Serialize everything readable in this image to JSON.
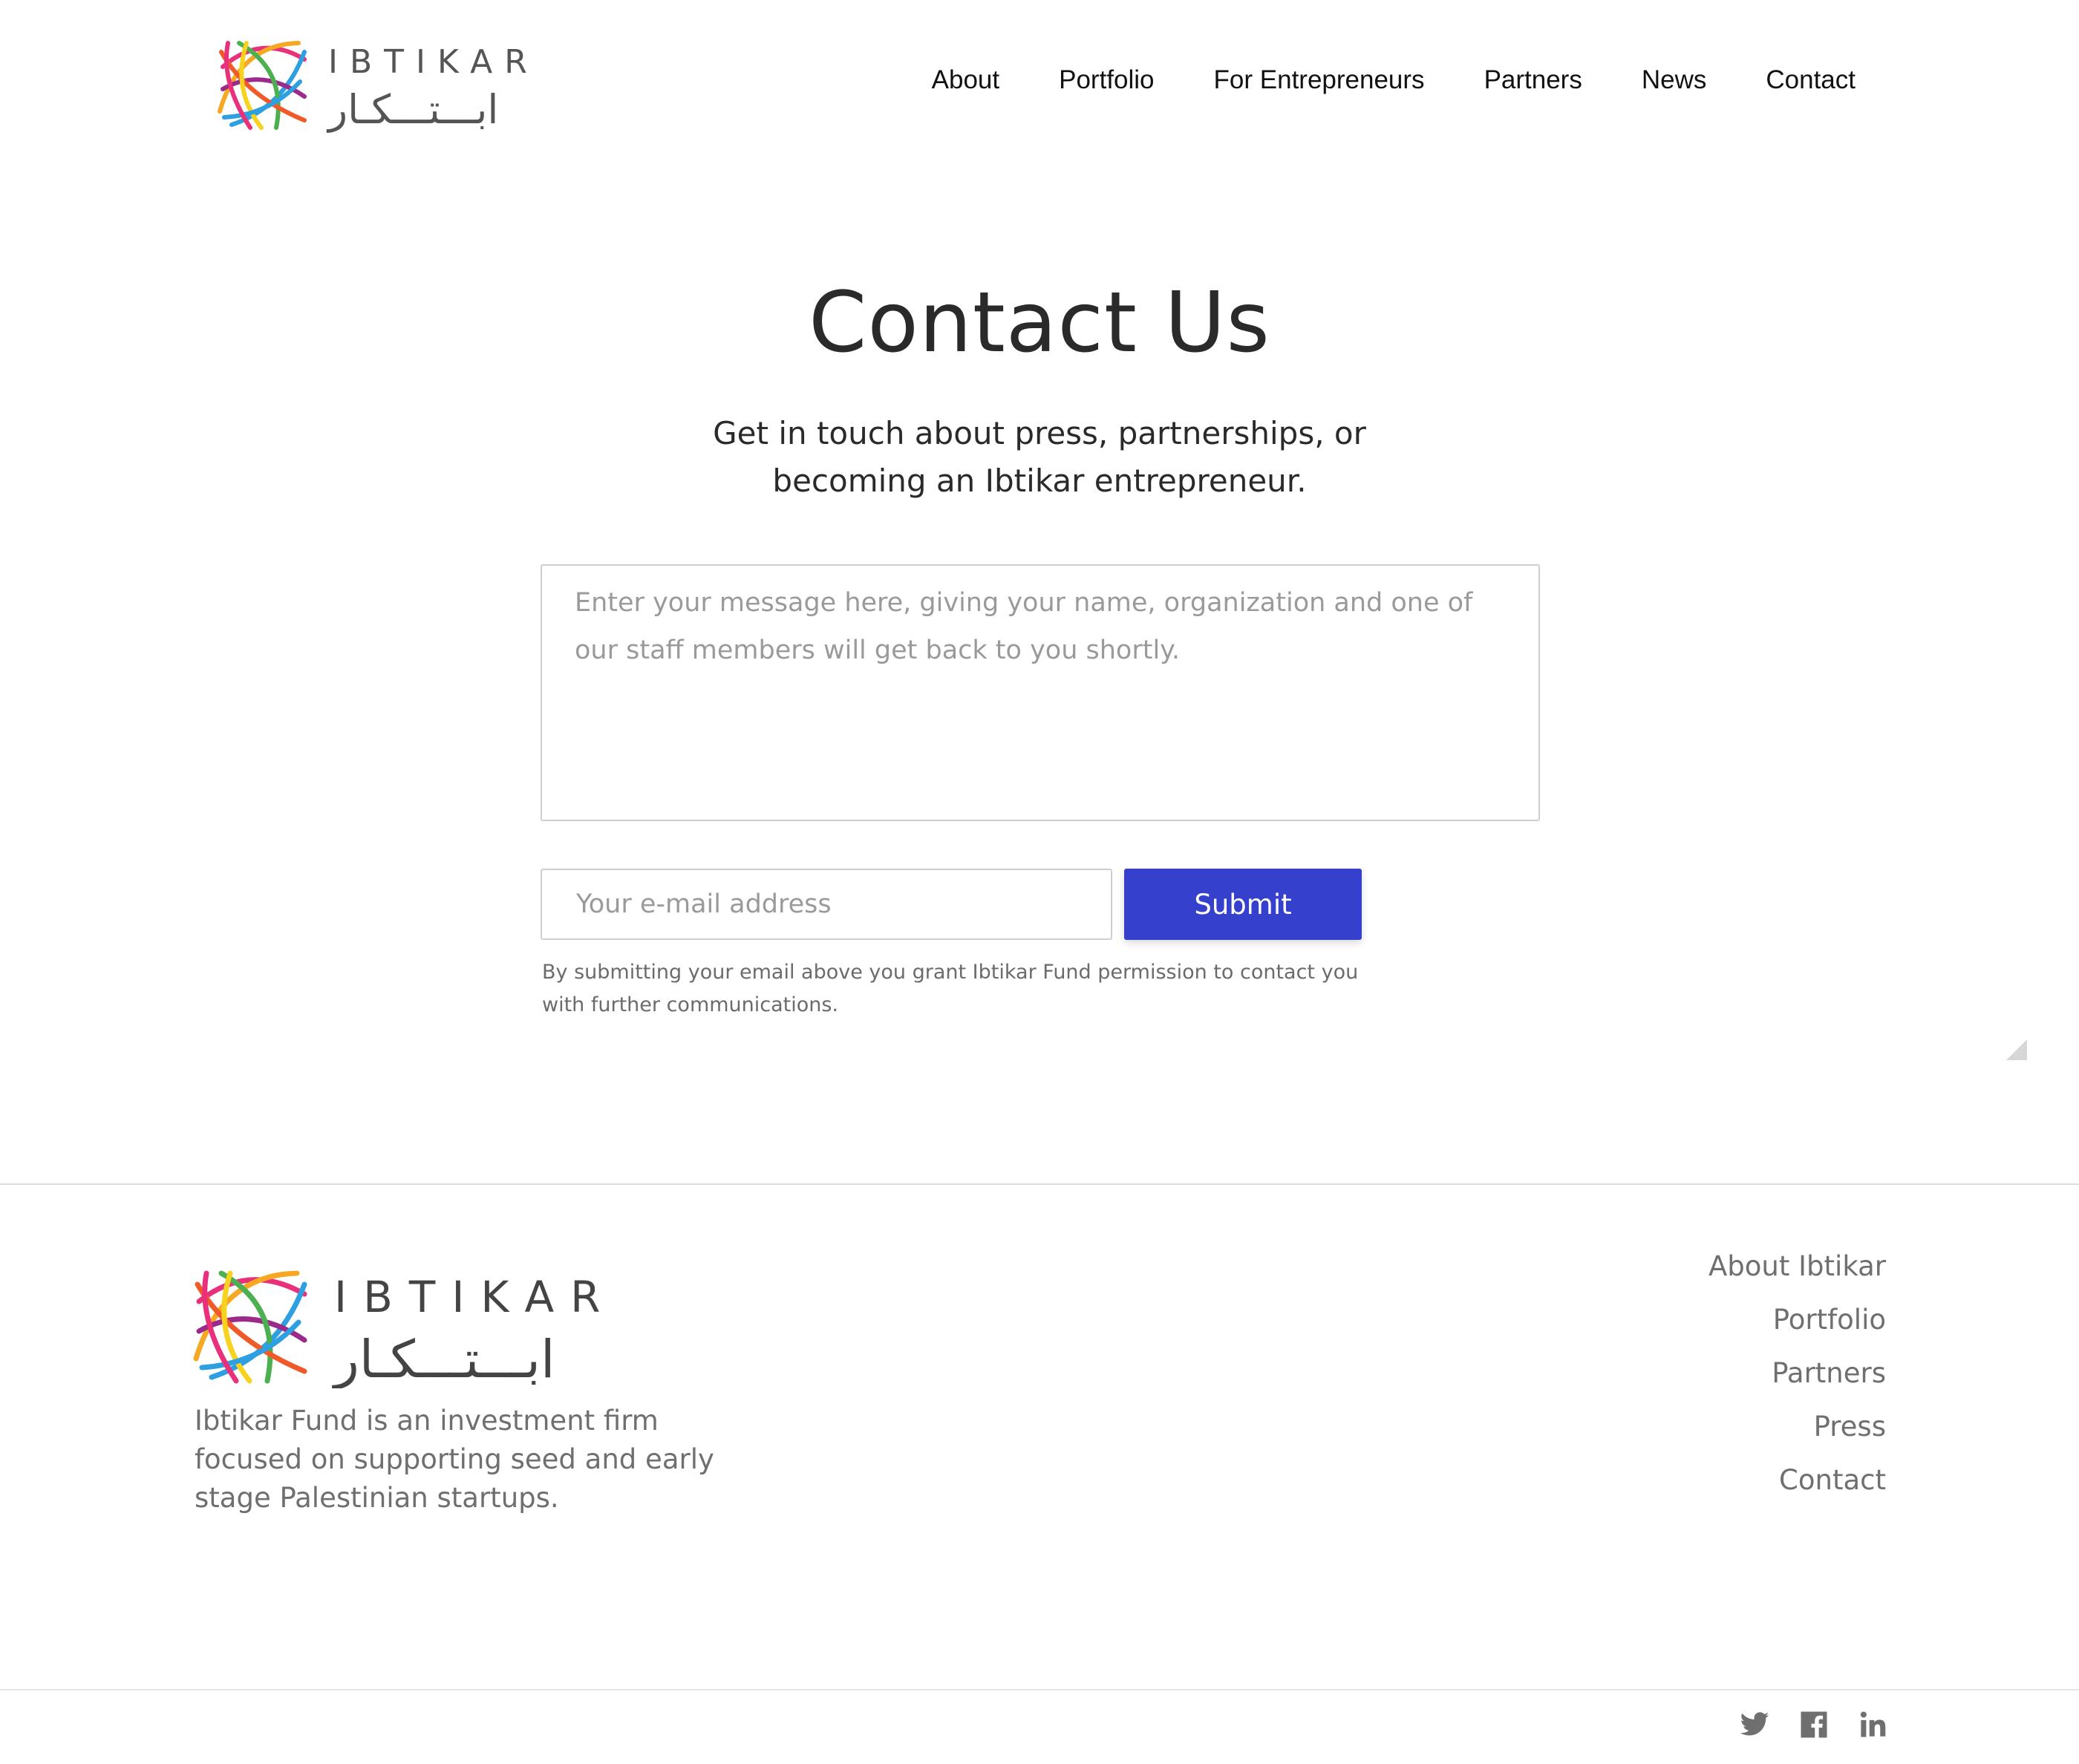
{
  "header": {
    "logo": {
      "latin": "IBTIKAR",
      "arabic": "ابـــتـــكـار"
    },
    "nav": [
      {
        "label": "About"
      },
      {
        "label": "Portfolio"
      },
      {
        "label": "For Entrepreneurs"
      },
      {
        "label": "Partners"
      },
      {
        "label": "News"
      },
      {
        "label": "Contact"
      }
    ]
  },
  "hero": {
    "title": "Contact Us",
    "subtitle_line1": "Get in touch about press, partnerships, or",
    "subtitle_line2": "becoming an Ibtikar entrepreneur."
  },
  "form": {
    "message_placeholder": "Enter your message here, giving your name, organization and one of our staff members will get back to you shortly.",
    "email_placeholder": "Your e-mail address",
    "submit_label": "Submit",
    "consent": "By submitting your email above you grant Ibtikar Fund permission to contact you with further communications."
  },
  "footer": {
    "logo": {
      "latin": "IBTIKAR",
      "arabic": "ابـــتـــكـار"
    },
    "description": "Ibtikar Fund is an investment firm focused on supporting seed and early stage Palestinian startups.",
    "links": [
      {
        "label": "About Ibtikar"
      },
      {
        "label": "Portfolio"
      },
      {
        "label": "Partners"
      },
      {
        "label": "Press"
      },
      {
        "label": "Contact"
      }
    ],
    "social": [
      {
        "icon": "twitter-icon"
      },
      {
        "icon": "facebook-icon"
      },
      {
        "icon": "linkedin-icon"
      }
    ]
  },
  "colors": {
    "accent": "#3540CC",
    "logo_palette": [
      "#E8317A",
      "#F7A823",
      "#2E9FE0",
      "#4CB050",
      "#9B2A8A",
      "#F05A28",
      "#F7D21E"
    ]
  }
}
